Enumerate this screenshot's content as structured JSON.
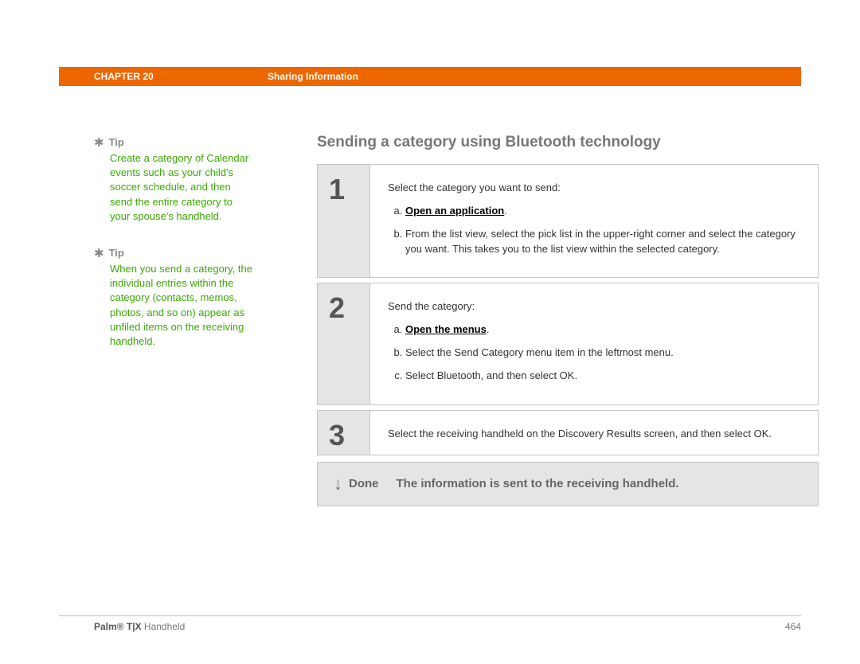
{
  "header": {
    "chapter": "CHAPTER 20",
    "title": "Sharing Information"
  },
  "sidebar": {
    "tips": [
      {
        "label": "Tip",
        "body": "Create a category of Calendar events such as your child's soccer schedule, and then send the entire category to your spouse's handheld."
      },
      {
        "label": "Tip",
        "body": "When you send a category, the individual entries within the category (contacts, memos, photos, and so on) appear as unfiled items on the receiving handheld."
      }
    ]
  },
  "main": {
    "title": "Sending a category using Bluetooth technology",
    "steps": [
      {
        "number": "1",
        "intro": "Select the category you want to send:",
        "items": [
          "Open an application",
          "From the list view, select the pick list in the upper-right corner and select the category you want. This takes you to the list view within the selected category."
        ],
        "link0": true
      },
      {
        "number": "2",
        "intro": "Send the category:",
        "items": [
          "Open the menus",
          "Select the Send Category menu item in the leftmost menu.",
          "Select Bluetooth, and then select OK."
        ],
        "link0": true
      },
      {
        "number": "3",
        "intro": "Select the receiving handheld on the Discovery Results screen, and then select OK."
      }
    ],
    "done": {
      "label": "Done",
      "text": "The information is sent to the receiving handheld."
    }
  },
  "footer": {
    "product_bold": "Palm® T|X",
    "product_rest": " Handheld",
    "page": "464"
  },
  "labels": {
    "a": "a.",
    "b": "b.",
    "c": "c.",
    "period": "."
  }
}
